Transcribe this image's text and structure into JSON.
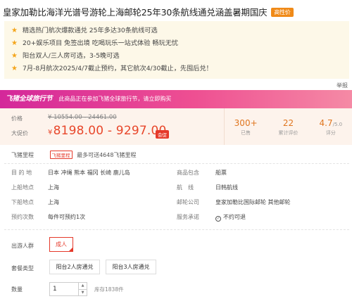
{
  "product": {
    "title": "皇家加勒比海洋光谱号游轮上海邮轮25年30条航线通兑涵盖暑期国庆",
    "tag": "高性价"
  },
  "highlights": [
    "精选热门航次爆款通兑 25年多达30条航线可选",
    "20+娱乐项目 免签出境 吃喝玩乐一站式体验 畅玩无忧",
    "阳台双人/三人房可选，3-5晚可选",
    "7月-8月航次2025/4/7截止预约，其它航次4/30截止，先囤后兑！"
  ],
  "report_label": "举报",
  "promo": {
    "brand": "飞猪全球旅行节",
    "text": "此商品正在参加飞猪全球旅行节，请立即购买"
  },
  "price": {
    "original_label": "价格",
    "original": "¥ 10554.00 - 24461.00",
    "current_label": "大促价",
    "currency": "¥",
    "current": "8198.00 - 9297.00",
    "vip_badge": "会促"
  },
  "stats": {
    "sold_value": "300+",
    "sold_label": "已售",
    "reviews_value": "22",
    "reviews_label": "累计评价",
    "score_value": "4.7",
    "score_max": "/5.0",
    "score_label": "评分"
  },
  "points": {
    "label": "飞猪里程",
    "badge": "飞猪里程",
    "text": "最多可送4648飞猪里程"
  },
  "info": {
    "destination_label": "目 的 地",
    "destination": "日本  冲绳  熊本  福冈  长崎  鹿儿岛",
    "includes_label": "商品包含",
    "includes": "船票",
    "board_label": "上船地点",
    "board": "上海",
    "route_label": "航　线",
    "route": "日韩航线",
    "alight_label": "下船地点",
    "alight": "上海",
    "company_label": "邮轮公司",
    "company": "皇家加勒比国际邮轮  其他邮轮",
    "booking_label": "预约次数",
    "booking": "每件可预约1次",
    "service_label": "服务承诺",
    "service": "不约可退"
  },
  "options": {
    "travelers_label": "出游人群",
    "travelers_option": "成人",
    "room_label": "套餐类型",
    "room_options": [
      "阳台2人房通兑",
      "阳台3人房通兑"
    ],
    "qty_label": "数量",
    "qty_value": "1",
    "stock": "库存1838件"
  }
}
